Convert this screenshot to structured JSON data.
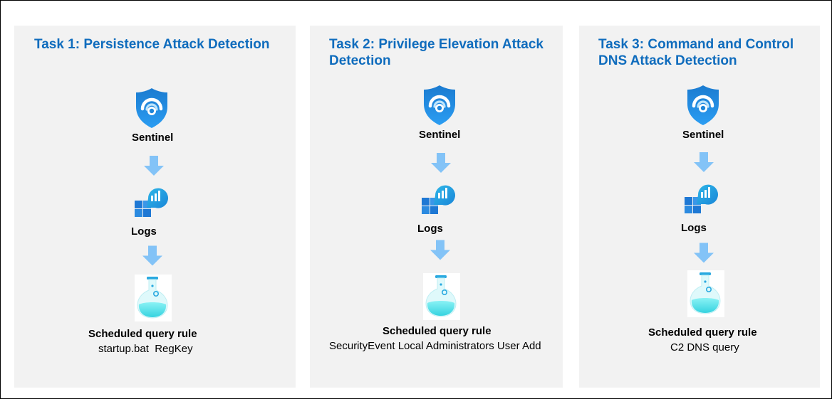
{
  "tasks": [
    {
      "title": "Task 1: Persistence Attack Detection",
      "sentinel_label": "Sentinel",
      "logs_label": "Logs",
      "rule_label": "Scheduled query rule",
      "rule_detail": "startup.bat  RegKey"
    },
    {
      "title": "Task 2: Privilege Elevation Attack Detection",
      "sentinel_label": "Sentinel",
      "logs_label": "Logs",
      "rule_label": "Scheduled query rule",
      "rule_detail": "SecurityEvent Local Administrators User Add"
    },
    {
      "title": "Task 3: Command and Control DNS Attack Detection",
      "sentinel_label": "Sentinel",
      "logs_label": "Logs",
      "rule_label": "Scheduled query rule",
      "rule_detail": "C2 DNS query"
    }
  ],
  "icons": {
    "sentinel": "sentinel-shield-icon",
    "logs": "log-analytics-icon",
    "rule": "flask-icon",
    "arrow": "arrow-down-icon"
  },
  "colors": {
    "title": "#0f6cbd",
    "panel": "#f2f2f2",
    "arrow": "#83c3f7",
    "shield": "#1f86d9"
  }
}
